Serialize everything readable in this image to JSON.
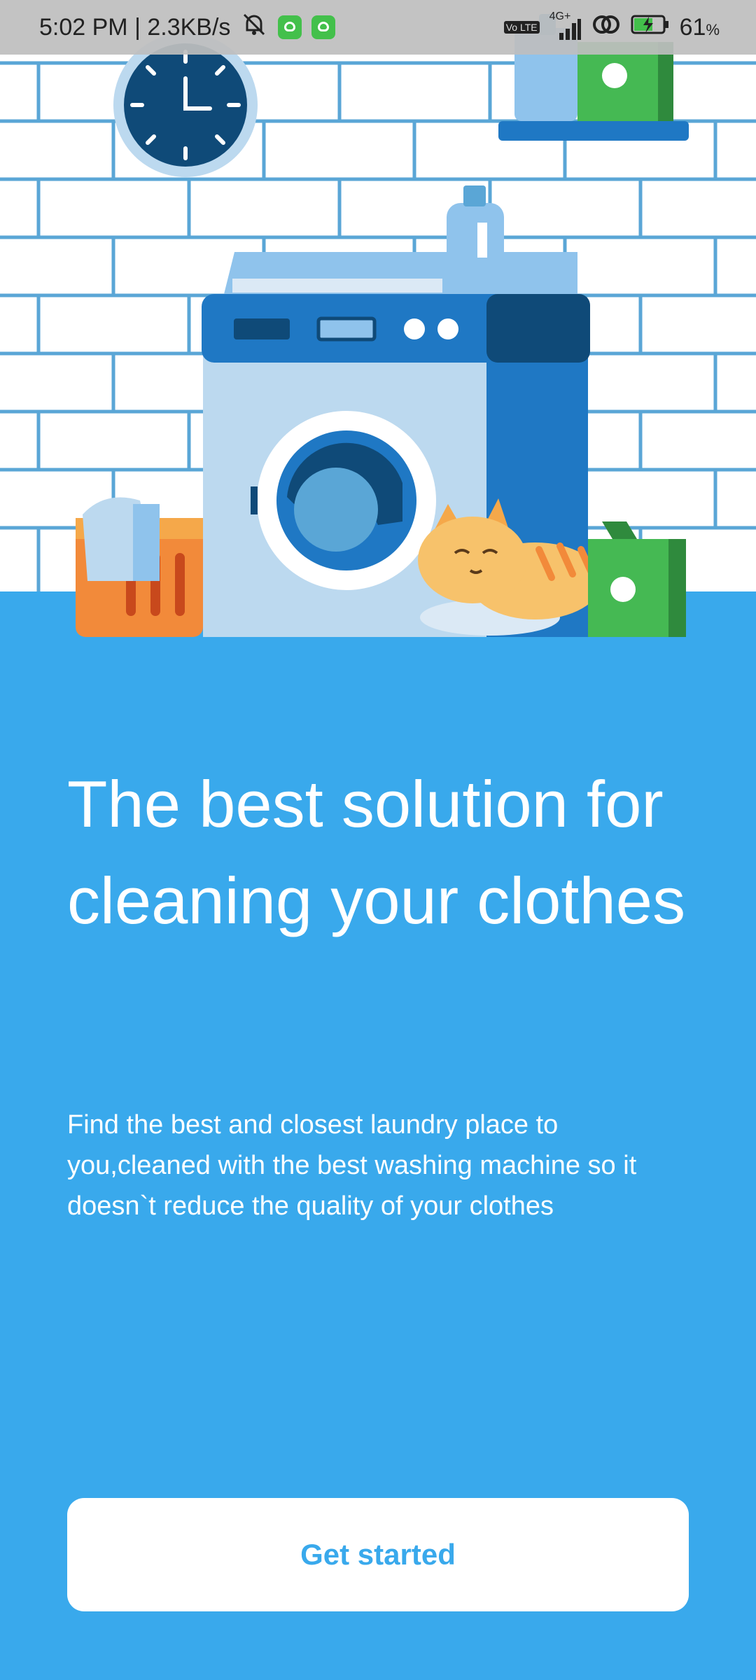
{
  "status_bar": {
    "time_speed": "5:02 PM | 2.3KB/s",
    "network": "4G+",
    "volte": "Vo LTE",
    "battery_percent": "61",
    "battery_unit": "%"
  },
  "onboarding": {
    "headline": "The best solution for cleaning your clothes",
    "description": "Find the best and closest laundry place to you,cleaned with the best washing machine so it doesn`t reduce the quality of your clothes",
    "cta_label": "Get started"
  },
  "colors": {
    "background": "#39a9ec",
    "button_bg": "#ffffff",
    "button_text": "#39a9ec"
  },
  "icons": [
    "mute-icon",
    "app-icon",
    "signal-icon",
    "hotspot-icon",
    "battery-charging-icon"
  ]
}
